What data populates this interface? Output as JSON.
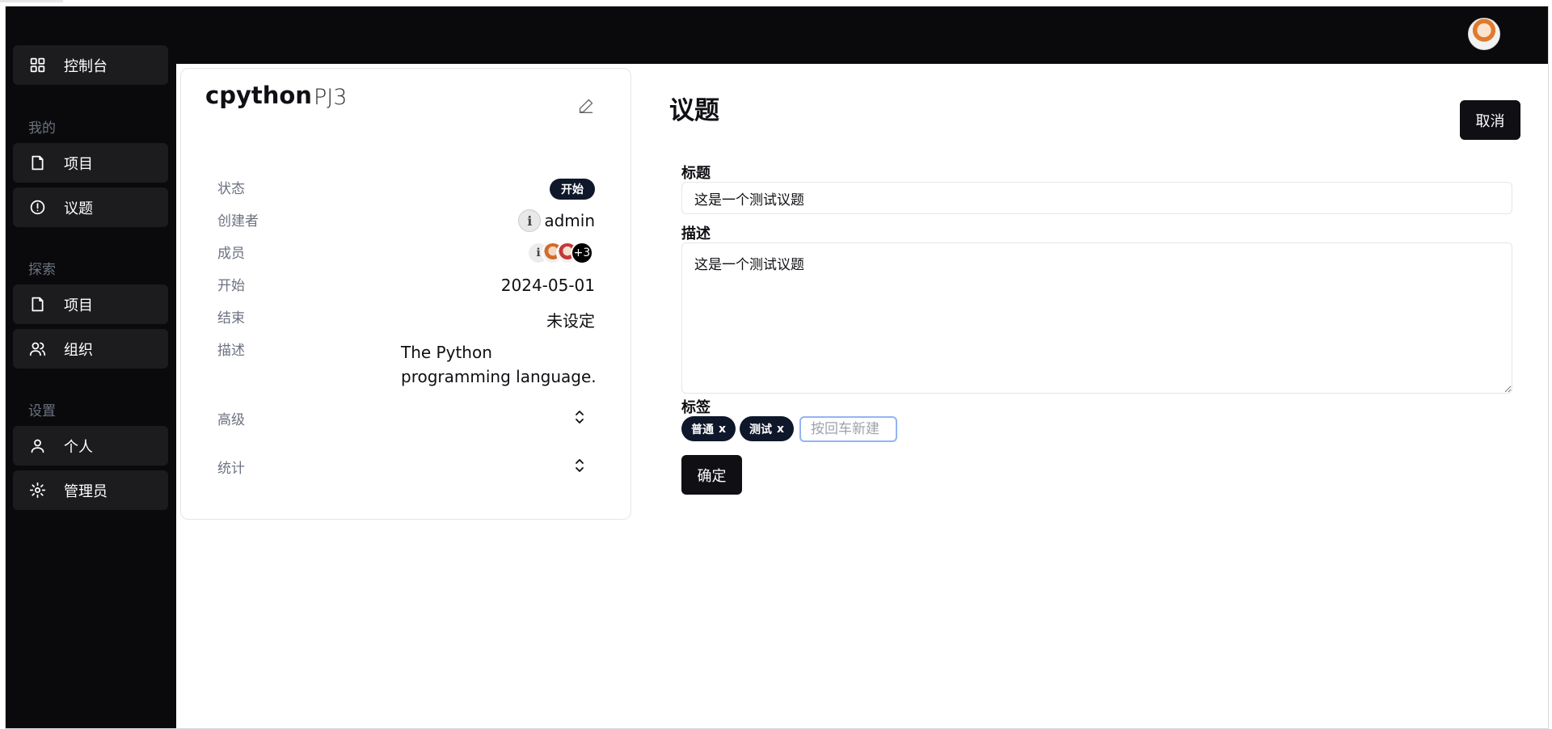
{
  "topbar": {
    "avatar_icon": "user-avatar-icon"
  },
  "sidebar": {
    "dashboard": "控制台",
    "groups": {
      "mine": "我的",
      "explore": "探索",
      "settings": "设置"
    },
    "mine_items": [
      "项目",
      "议题"
    ],
    "explore_items": [
      "项目",
      "组织"
    ],
    "settings_items": [
      "个人",
      "管理员"
    ]
  },
  "project": {
    "name": "cpython",
    "key": "PJ3",
    "labels": {
      "status": "状态",
      "creator": "创建者",
      "members": "成员",
      "start": "开始",
      "end": "结束",
      "description": "描述",
      "advanced": "高级",
      "stats": "统计"
    },
    "status": "开始",
    "creator": "admin",
    "members_more": "+3",
    "start": "2024-05-01",
    "end": "未设定",
    "description": "The Python programming language."
  },
  "issue_form": {
    "heading": "议题",
    "cancel": "取消",
    "title_label": "标题",
    "title_value": "这是一个测试议题",
    "desc_label": "描述",
    "desc_value": "这是一个测试议题",
    "tags_label": "标签",
    "tags": [
      "普通",
      "测试"
    ],
    "tag_remove": "x",
    "tag_placeholder": "按回车新建",
    "submit": "确定"
  }
}
